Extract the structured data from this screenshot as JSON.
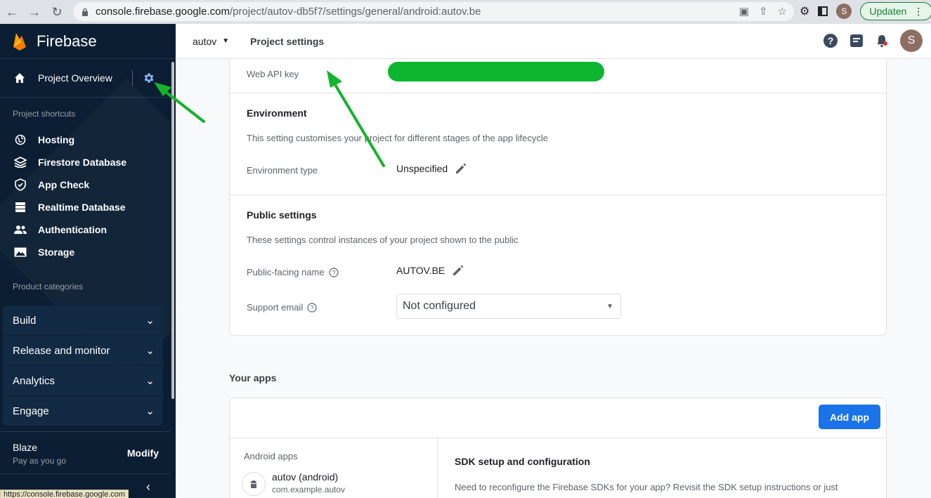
{
  "browser": {
    "url_host": "console.firebase.google.com",
    "url_path": "/project/autov-db5f7/settings/general/android:autov.be",
    "profile_initial": "S",
    "update_label": "Updaten",
    "status_url": "https://console.firebase.google.com"
  },
  "sidebar": {
    "brand": "Firebase",
    "overview": "Project Overview",
    "shortcuts_label": "Project shortcuts",
    "shortcuts": [
      {
        "label": "Hosting",
        "icon": "globe-icon"
      },
      {
        "label": "Firestore Database",
        "icon": "firestore-icon"
      },
      {
        "label": "App Check",
        "icon": "shield-icon"
      },
      {
        "label": "Realtime Database",
        "icon": "database-icon"
      },
      {
        "label": "Authentication",
        "icon": "people-icon"
      },
      {
        "label": "Storage",
        "icon": "image-icon"
      }
    ],
    "categories_label": "Product categories",
    "categories": [
      "Build",
      "Release and monitor",
      "Analytics",
      "Engage"
    ],
    "plan": {
      "tier": "Blaze",
      "sub": "Pay as you go",
      "action": "Modify"
    }
  },
  "topbar": {
    "project": "autov",
    "title": "Project settings",
    "avatar_initial": "S"
  },
  "settings": {
    "web_api_key_label": "Web API key",
    "environment": {
      "title": "Environment",
      "desc": "This setting customises your project for different stages of the app lifecycle",
      "type_label": "Environment type",
      "type_value": "Unspecified"
    },
    "public": {
      "title": "Public settings",
      "desc": "These settings control instances of your project shown to the public",
      "name_label": "Public-facing name",
      "name_value": "AUTOV.BE",
      "email_label": "Support email",
      "email_value": "Not configured"
    }
  },
  "apps": {
    "title": "Your apps",
    "add_label": "Add app",
    "android_label": "Android apps",
    "app_name": "autov (android)",
    "app_package": "com.example.autov",
    "sdk_title": "SDK setup and configuration",
    "sdk_desc": "Need to reconfigure the Firebase SDKs for your app? Revisit the SDK setup instructions or just"
  },
  "colors": {
    "sidebar_bg": "#0b1e33",
    "primary": "#1a73e8",
    "annotation_green": "#14b32b"
  }
}
